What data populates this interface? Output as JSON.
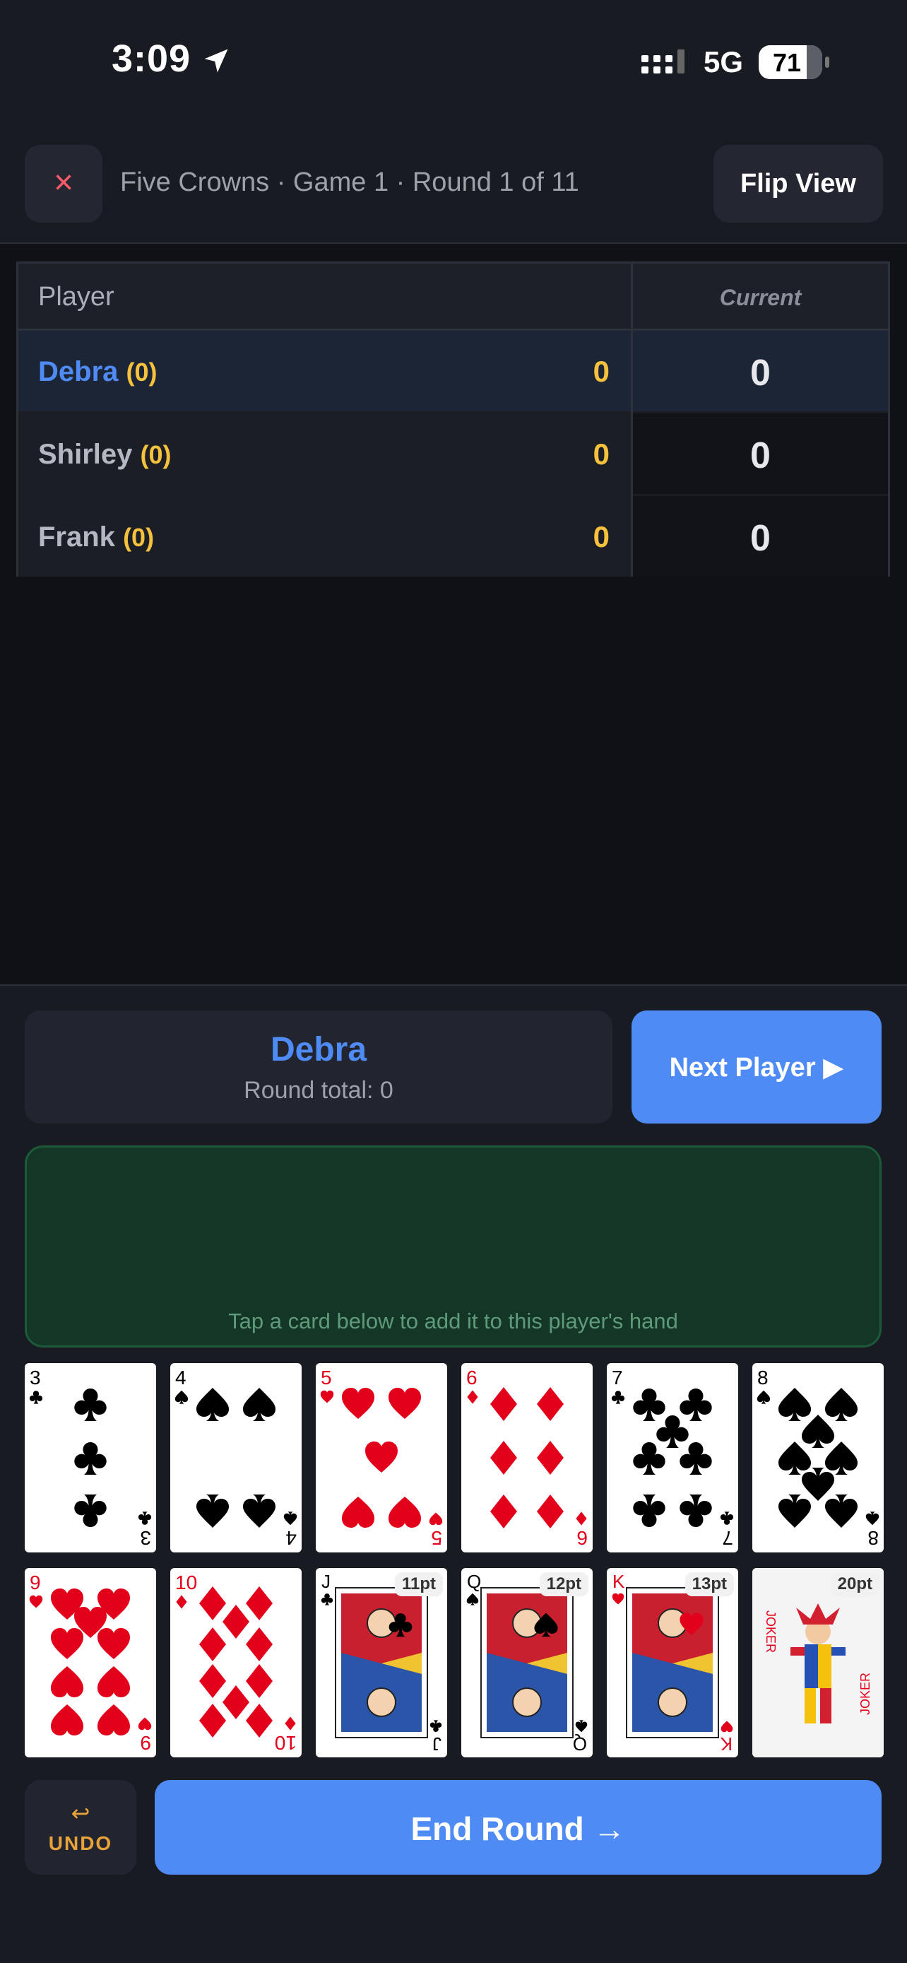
{
  "status_bar": {
    "time": "3:09",
    "network": "5G",
    "battery": "71"
  },
  "header": {
    "title": "Five Crowns · Game 1 · Round 1 of 11",
    "close_symbol": "×",
    "flip_label": "Flip View"
  },
  "table": {
    "col_player": "Player",
    "col_current": "Current",
    "rows": [
      {
        "name": "Debra",
        "badge": "(0)",
        "total": "0",
        "current": "0",
        "active": true
      },
      {
        "name": "Shirley",
        "badge": "(0)",
        "total": "0",
        "current": "0",
        "active": false
      },
      {
        "name": "Frank",
        "badge": "(0)",
        "total": "0",
        "current": "0",
        "active": false
      }
    ]
  },
  "current_player": {
    "name": "Debra",
    "round_total": "Round total: 0"
  },
  "next_player_label": "Next Player ▶",
  "hand_hint": "Tap a card below to add it to this player's hand",
  "cards": [
    {
      "rank": "3",
      "suit": "clubs",
      "color": "#000000"
    },
    {
      "rank": "4",
      "suit": "spades",
      "color": "#000000"
    },
    {
      "rank": "5",
      "suit": "hearts",
      "color": "#e3001b"
    },
    {
      "rank": "6",
      "suit": "diamonds",
      "color": "#e3001b"
    },
    {
      "rank": "7",
      "suit": "clubs",
      "color": "#000000"
    },
    {
      "rank": "8",
      "suit": "spades",
      "color": "#000000"
    },
    {
      "rank": "9",
      "suit": "hearts",
      "color": "#e3001b"
    },
    {
      "rank": "10",
      "suit": "diamonds",
      "color": "#e3001b"
    },
    {
      "rank": "J",
      "suit": "clubs",
      "color": "#000000",
      "points": "11pt"
    },
    {
      "rank": "Q",
      "suit": "spades",
      "color": "#000000",
      "points": "12pt"
    },
    {
      "rank": "K",
      "suit": "hearts",
      "color": "#e3001b",
      "points": "13pt"
    },
    {
      "rank": "JOKER",
      "suit": "joker",
      "color": "#e3001b",
      "points": "20pt"
    }
  ],
  "undo": {
    "icon": "↩",
    "label": "UNDO"
  },
  "end_round_label": "End Round →"
}
